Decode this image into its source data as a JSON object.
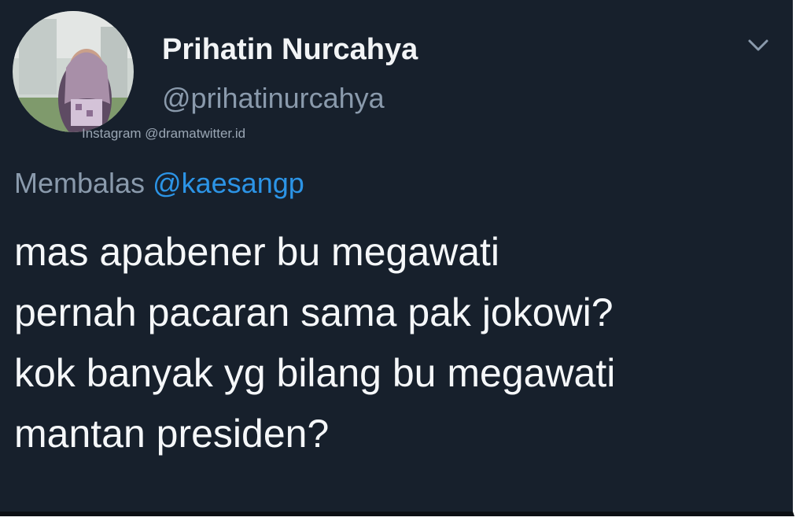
{
  "tweet": {
    "display_name": "Prihatin Nurcahya",
    "handle": "@prihatinurcahya",
    "watermark": "Instagram @dramatwitter.id",
    "reply_prefix": "Membalas",
    "reply_to": "@kaesangp",
    "text_lines": [
      "mas apabener bu megawati",
      "pernah pacaran sama pak jokowi?",
      "kok banyak yg bilang bu megawati",
      "mantan presiden?"
    ],
    "menu_icon": "chevron-down-icon",
    "avatar_icon": "avatar"
  },
  "colors": {
    "background": "#17202c",
    "name": "#f2f4f6",
    "secondary_text": "#8a9aac",
    "mention": "#2c94e6",
    "body_text": "#f5f7f9"
  }
}
